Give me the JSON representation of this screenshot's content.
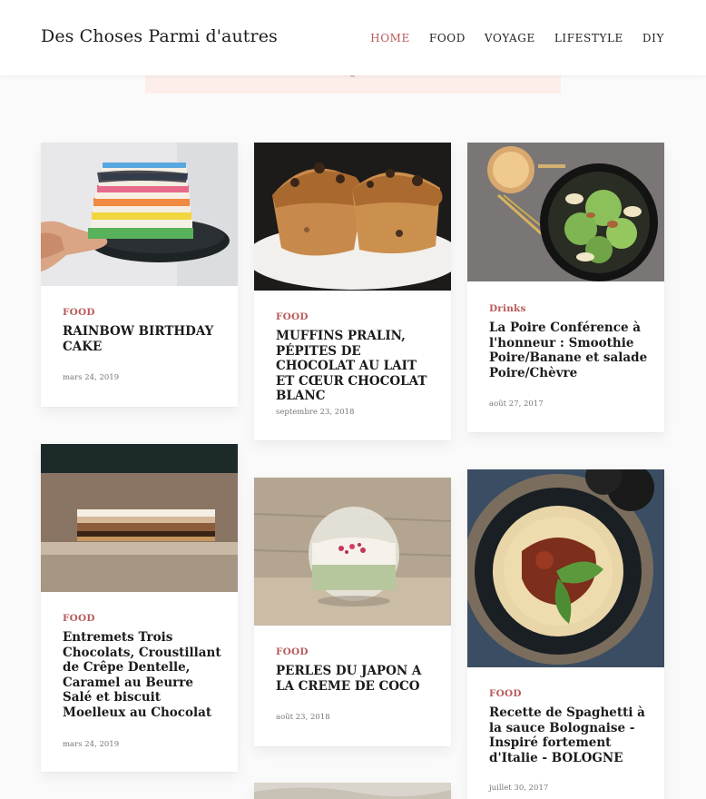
{
  "site": {
    "title": "Des Choses Parmi d'autres"
  },
  "nav": [
    {
      "label": "HOME",
      "active": true
    },
    {
      "label": "FOOD"
    },
    {
      "label": "VOYAGE"
    },
    {
      "label": "LIFESTYLE"
    },
    {
      "label": "DIY"
    }
  ],
  "posts": [
    {
      "category": "FOOD",
      "title": "RAINBOW BIRTHDAY CAKE",
      "date": "mars 24, 2019",
      "image": "rainbow-cake-photo"
    },
    {
      "category": "FOOD",
      "title": "MUFFINS PRALIN, PÉPITES DE CHOCOLAT AU LAIT ET CŒUR CHOCOLAT BLANC",
      "date": "septembre 23, 2018",
      "image": "muffins-photo"
    },
    {
      "category": "Drinks",
      "title": "La Poire Conférence à l'honneur : Smoothie Poire/Banane et salade Poire/Chèvre",
      "date": "août 27, 2017",
      "image": "pear-salad-smoothie-photo"
    },
    {
      "category": "FOOD",
      "title": "Entremets Trois Chocolats, Croustillant de Crêpe Dentelle, Caramel au Beurre Salé et biscuit Moelleux au Chocolat",
      "date": "mars 24, 2019",
      "image": "entremets-photo"
    },
    {
      "category": "FOOD",
      "title": "PERLES DU JAPON A LA CREME DE COCO",
      "date": "août 23, 2018",
      "image": "tapioca-pearls-photo"
    },
    {
      "category": "FOOD",
      "title": "Recette de Spaghetti à la sauce Bolognaise - Inspiré fortement d'Italie - BOLOGNE",
      "date": "juillet 30, 2017",
      "image": "spaghetti-bolognese-photo"
    }
  ]
}
